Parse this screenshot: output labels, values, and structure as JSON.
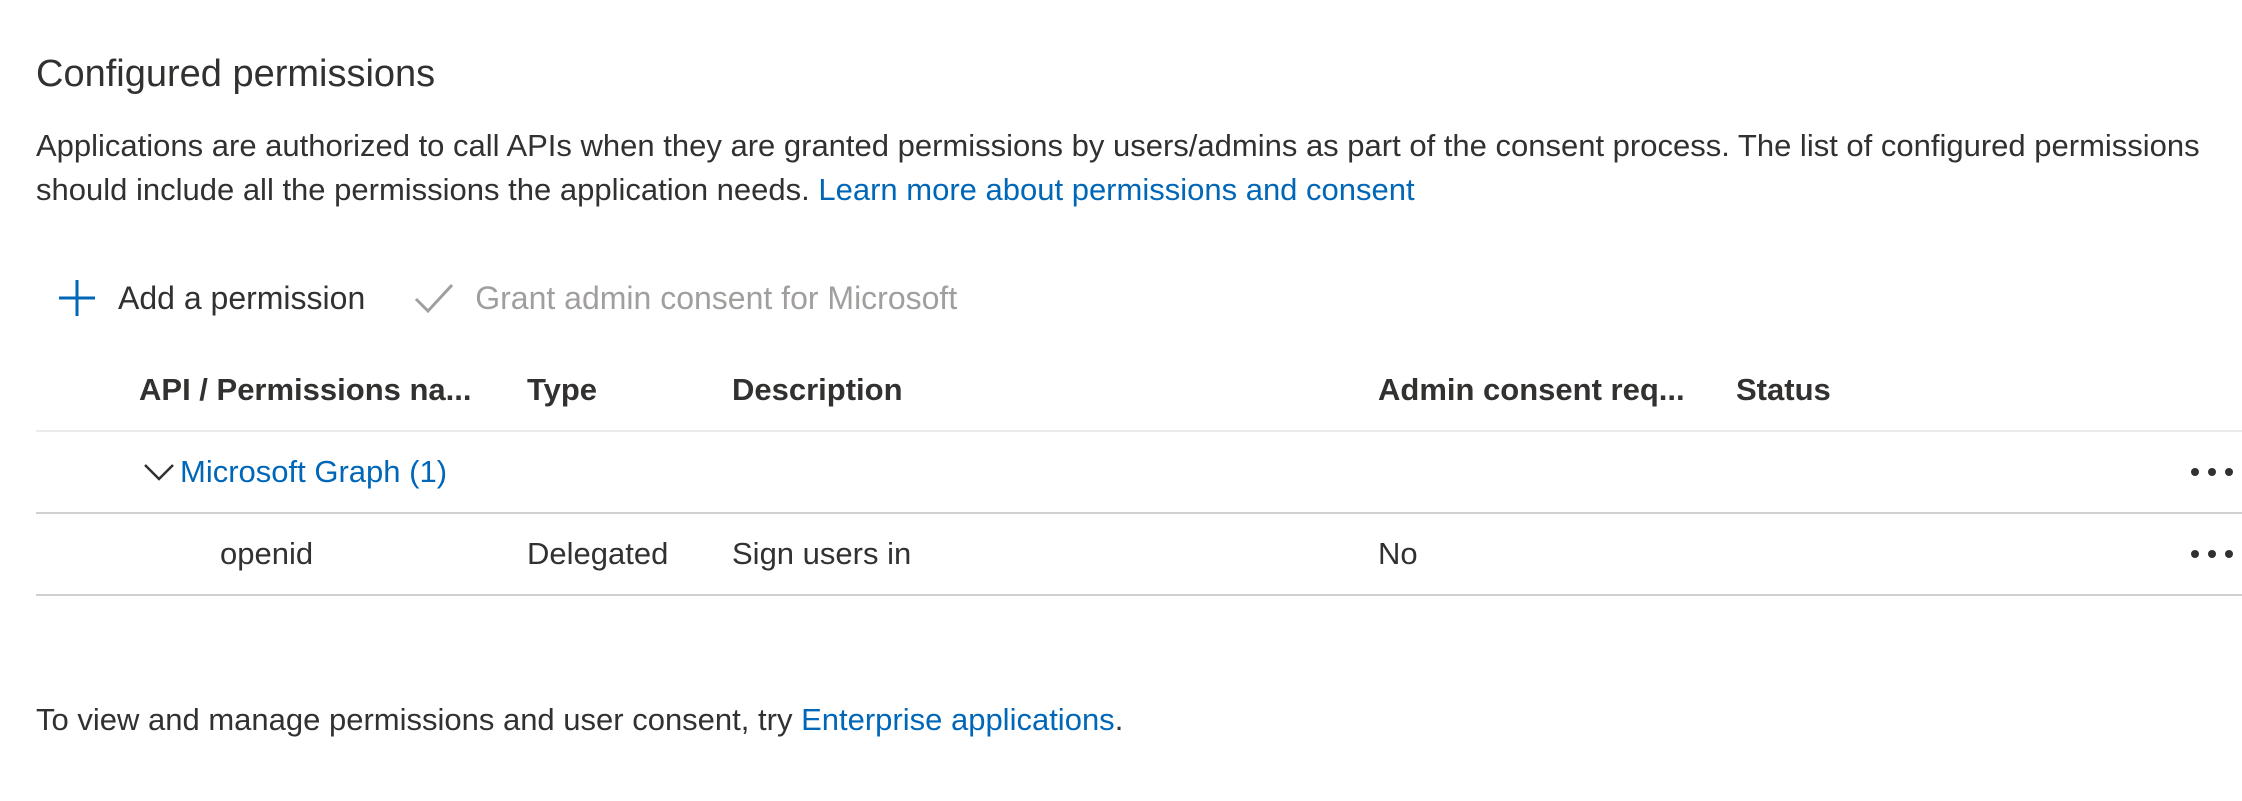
{
  "section": {
    "title": "Configured permissions",
    "description": "Applications are authorized to call APIs when they are granted permissions by users/admins as part of the consent process. The list of configured permissions should include all the permissions the application needs. ",
    "learn_more_link": "Learn more about permissions and consent"
  },
  "toolbar": {
    "add_label": "Add a permission",
    "grant_label": "Grant admin consent for Microsoft",
    "add_icon": "plus-icon",
    "grant_icon": "checkmark-icon"
  },
  "table": {
    "columns": [
      "API / Permissions na...",
      "Type",
      "Description",
      "Admin consent req...",
      "Status"
    ],
    "groups": [
      {
        "label": "Microsoft Graph (1)",
        "expanded": true,
        "rows": [
          {
            "name": "openid",
            "type": "Delegated",
            "description": "Sign users in",
            "admin_consent": "No",
            "status": ""
          }
        ]
      }
    ]
  },
  "footer": {
    "text_before": "To view and manage permissions and user consent, try ",
    "link": "Enterprise applications",
    "text_after": "."
  },
  "colors": {
    "link": "#0067b8",
    "text": "#323130",
    "disabled": "#a19f9d",
    "divider": "#d2d0ce"
  }
}
